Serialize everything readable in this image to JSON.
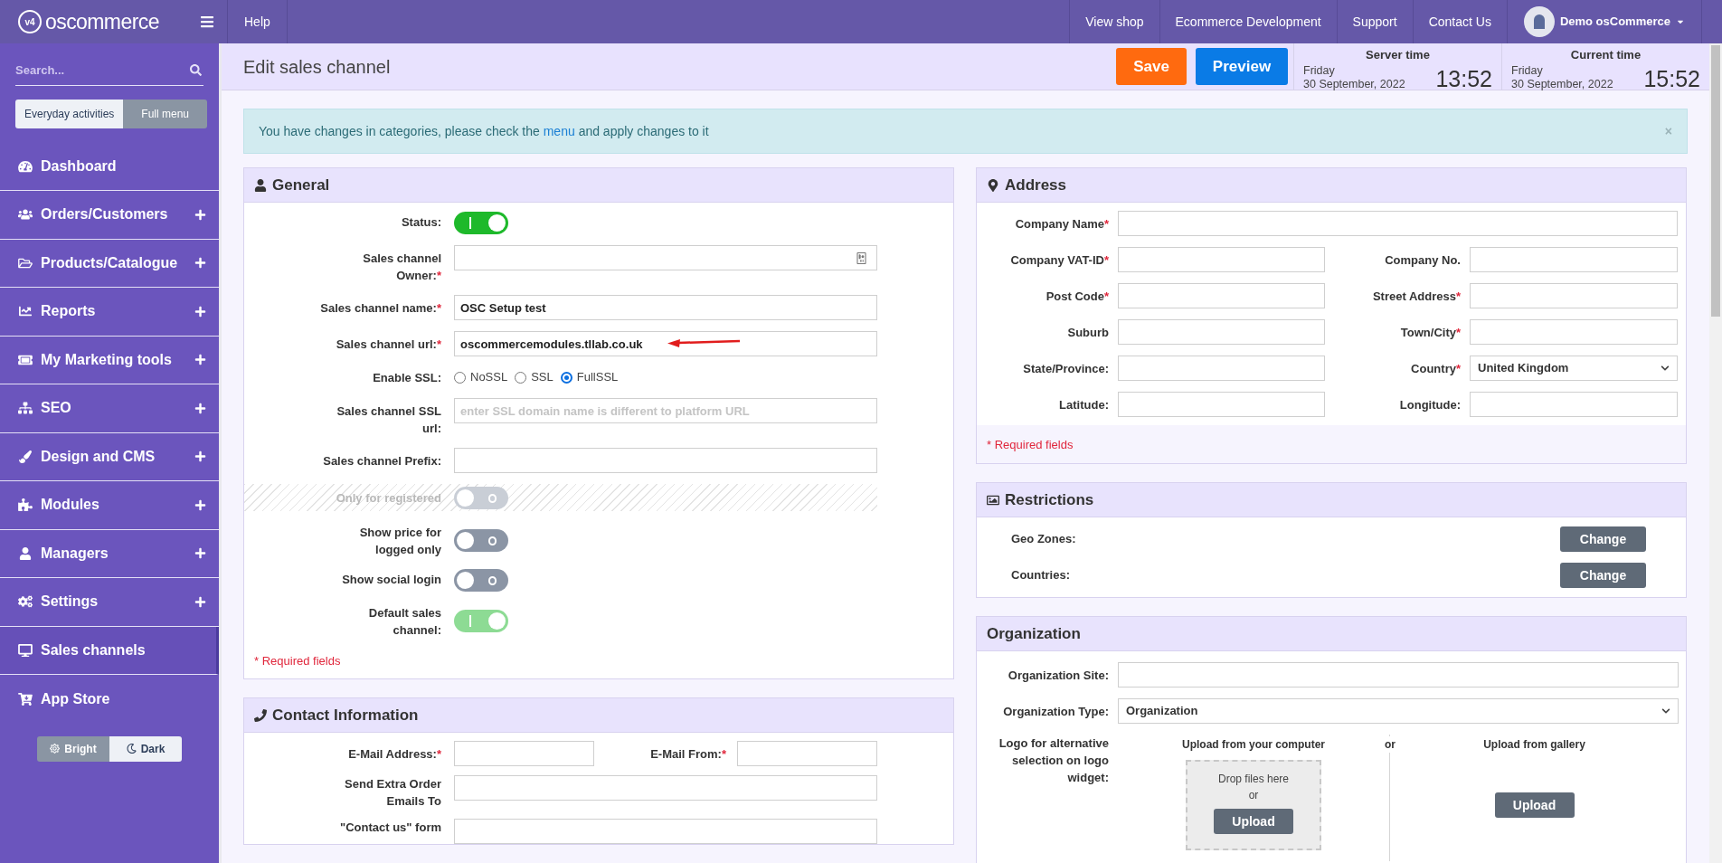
{
  "topbar": {
    "logo_badge": "v4",
    "logo_text": "oscommerce",
    "help": "Help",
    "links": [
      "View shop",
      "Ecommerce Development",
      "Support",
      "Contact Us"
    ],
    "user": "Demo osCommerce"
  },
  "sidebar": {
    "search_placeholder": "Search...",
    "modes": [
      {
        "label": "Everyday activities",
        "selected": false
      },
      {
        "label": "Full menu",
        "selected": true
      }
    ],
    "items": [
      {
        "label": "Dashboard",
        "expandable": false,
        "selected": false
      },
      {
        "label": "Orders/Customers",
        "expandable": true,
        "selected": false
      },
      {
        "label": "Products/Catalogue",
        "expandable": true,
        "selected": false
      },
      {
        "label": "Reports",
        "expandable": true,
        "selected": false
      },
      {
        "label": "My Marketing tools",
        "expandable": true,
        "selected": false
      },
      {
        "label": "SEO",
        "expandable": true,
        "selected": false
      },
      {
        "label": "Design and CMS",
        "expandable": true,
        "selected": false
      },
      {
        "label": "Modules",
        "expandable": true,
        "selected": false
      },
      {
        "label": "Managers",
        "expandable": true,
        "selected": false
      },
      {
        "label": "Settings",
        "expandable": true,
        "selected": false
      },
      {
        "label": "Sales channels",
        "expandable": false,
        "selected": true
      },
      {
        "label": "App Store",
        "expandable": false,
        "selected": false
      }
    ],
    "themes": [
      {
        "label": "Bright",
        "selected": true
      },
      {
        "label": "Dark",
        "selected": false
      }
    ]
  },
  "header": {
    "title": "Edit sales channel",
    "save": "Save",
    "preview": "Preview",
    "clocks": [
      {
        "label": "Server time",
        "day": "Friday",
        "date": "30 September, 2022",
        "time": "13:52"
      },
      {
        "label": "Current time",
        "day": "Friday",
        "date": "30 September, 2022",
        "time": "15:52"
      }
    ]
  },
  "alert": {
    "before": "You have changes in categories, please check the",
    "link": "menu",
    "after": "and apply changes to it",
    "close": "×"
  },
  "general": {
    "title": "General",
    "rows": [
      {
        "kind": "toggle",
        "label": "Status:",
        "on": true,
        "disabled": false,
        "readonly": false
      },
      {
        "kind": "field",
        "label": "Sales channel Owner:",
        "req": "*",
        "value": "",
        "picker": true
      },
      {
        "kind": "field",
        "label": "Sales channel name:",
        "req": "*",
        "value": "OSC Setup test"
      },
      {
        "kind": "field",
        "label": "Sales channel url:",
        "req": "*",
        "value": "oscommercemodules.tllab.co.uk",
        "arrow": true
      },
      {
        "kind": "radio",
        "label": "Enable SSL:",
        "options": [
          {
            "label": "NoSSL",
            "selected": false
          },
          {
            "label": "SSL",
            "selected": false
          },
          {
            "label": "FullSSL",
            "selected": true
          }
        ]
      },
      {
        "kind": "field",
        "label": "Sales channel SSL url:",
        "placeholder": "enter SSL domain name is different to platform URL",
        "value": ""
      },
      {
        "kind": "field",
        "label": "Sales channel Prefix:",
        "value": ""
      },
      {
        "kind": "toggle",
        "label": "Only for registered",
        "on": false,
        "disabled": true,
        "readonly": false
      },
      {
        "kind": "toggle",
        "label": "Show price for logged only",
        "on": false,
        "disabled": false,
        "readonly": false
      },
      {
        "kind": "toggle",
        "label": "Show social login",
        "on": false,
        "disabled": false,
        "readonly": false
      },
      {
        "kind": "toggle",
        "label": "Default sales channel:",
        "on": true,
        "disabled": false,
        "readonly": true
      }
    ],
    "required_note": "* Required fields"
  },
  "contact": {
    "title": "Contact Information",
    "email_label": "E-Mail Address:",
    "email_req": "*",
    "from_label": "E-Mail From:",
    "from_req": "*",
    "extra_label": "Send Extra Order Emails To",
    "form_label": "\"Contact us\" form"
  },
  "address": {
    "title": "Address",
    "fields": [
      {
        "label": "Company Name",
        "req": "*",
        "wide": true
      },
      {
        "label": "Company VAT-ID",
        "req": "*"
      },
      {
        "label": "Company No."
      },
      {
        "label": "Post Code",
        "req": "*"
      },
      {
        "label": "Street Address",
        "req": "*"
      },
      {
        "label": "Suburb"
      },
      {
        "label": "Town/City",
        "req": "*"
      },
      {
        "label": "State/Province:"
      },
      {
        "label": "Country",
        "req": "*",
        "select": "United Kingdom"
      },
      {
        "label": "Latitude:"
      },
      {
        "label": "Longitude:"
      }
    ],
    "required_note": "* Required fields"
  },
  "restrictions": {
    "title": "Restrictions",
    "rows": [
      {
        "label": "Geo Zones:",
        "button": "Change"
      },
      {
        "label": "Countries:",
        "button": "Change"
      }
    ]
  },
  "organization": {
    "title": "Organization",
    "site_label": "Organization Site:",
    "type_label": "Organization Type:",
    "type_value": "Organization",
    "logo_label": "Logo for alternative selection on logo widget:",
    "computer_title": "Upload from your computer",
    "drop_text": "Drop files here",
    "drop_or": "or",
    "upload": "Upload",
    "or": "or",
    "gallery_title": "Upload from gallery",
    "gallery_upload": "Upload"
  }
}
